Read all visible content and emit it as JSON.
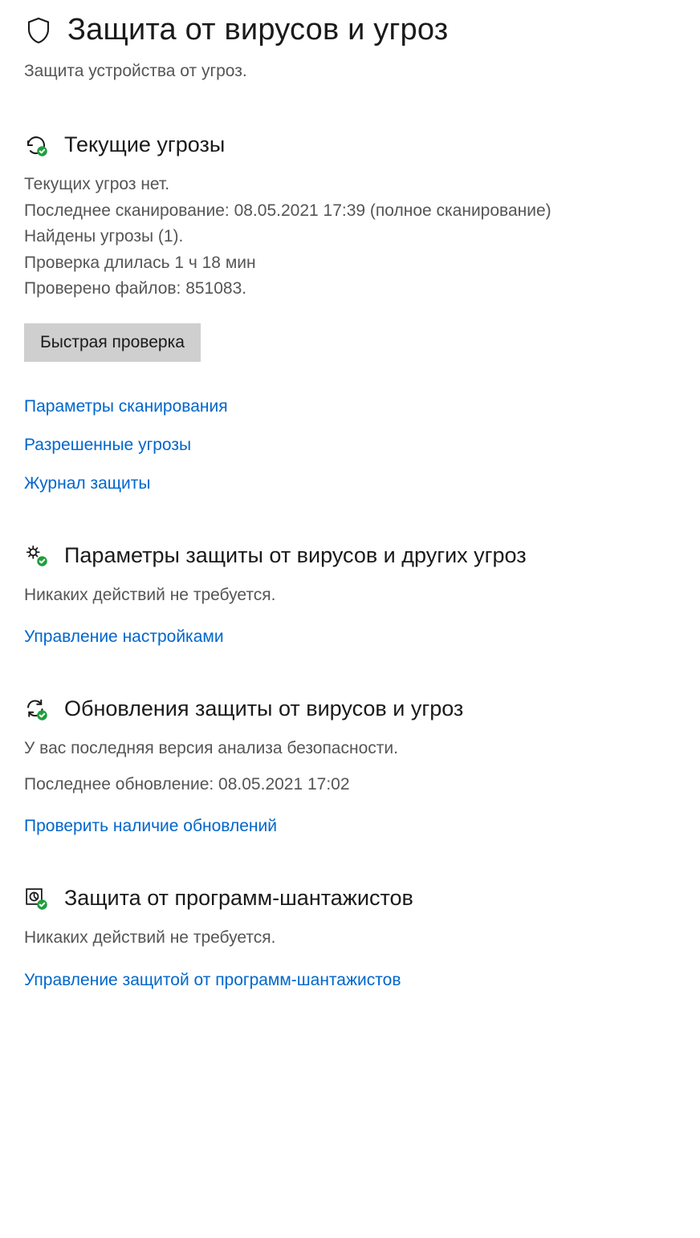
{
  "header": {
    "title": "Защита от вирусов и угроз",
    "subtitle": "Защита устройства от угроз."
  },
  "currentThreats": {
    "title": "Текущие угрозы",
    "noThreats": "Текущих угроз нет.",
    "lastScan": "Последнее сканирование: 08.05.2021 17:39 (полное сканирование)",
    "foundThreats": "Найдены угрозы (1).",
    "duration": "Проверка длилась 1 ч 18 мин",
    "filesChecked": "Проверено файлов: 851083.",
    "quickScanButton": "Быстрая проверка",
    "links": {
      "scanOptions": "Параметры сканирования",
      "allowedThreats": "Разрешенные угрозы",
      "protectionHistory": "Журнал защиты"
    }
  },
  "protectionSettings": {
    "title": "Параметры защиты от вирусов и других угроз",
    "status": "Никаких действий не требуется.",
    "manageLink": "Управление настройками"
  },
  "updates": {
    "title": "Обновления защиты от вирусов и угроз",
    "status": "У вас последняя версия анализа безопасности.",
    "lastUpdate": "Последнее обновление: 08.05.2021 17:02",
    "checkLink": "Проверить наличие обновлений"
  },
  "ransomware": {
    "title": "Защита от программ-шантажистов",
    "status": "Никаких действий не требуется.",
    "manageLink": "Управление защитой от программ-шантажистов"
  }
}
